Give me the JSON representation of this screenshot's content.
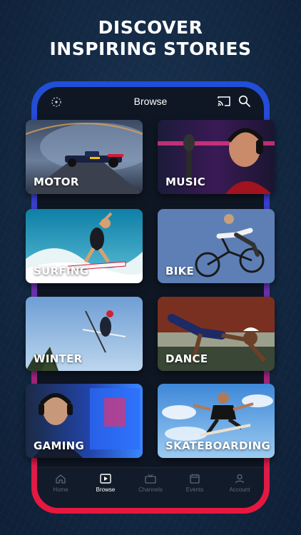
{
  "headline": [
    "DISCOVER",
    "INSPIRING STORIES"
  ],
  "app": {
    "title": "Browse",
    "icons": {
      "left": "red-bull-logo-icon",
      "cast": "cast-icon",
      "search": "search-icon"
    }
  },
  "categories": [
    "MOTOR",
    "MUSIC",
    "SURFING",
    "BIKE",
    "WINTER",
    "DANCE",
    "GAMING",
    "SKATEBOARDING"
  ],
  "tabs": [
    {
      "label": "Home",
      "icon": "home-icon",
      "active": false
    },
    {
      "label": "Browse",
      "icon": "play-icon",
      "active": true
    },
    {
      "label": "Channels",
      "icon": "tv-icon",
      "active": false
    },
    {
      "label": "Events",
      "icon": "calendar-icon",
      "active": false
    },
    {
      "label": "Account",
      "icon": "user-icon",
      "active": false
    }
  ],
  "colors": {
    "background": "#142a45",
    "frame_top": "#1f4fd8",
    "frame_bottom": "#e8173e",
    "screen": "#0f1724"
  }
}
